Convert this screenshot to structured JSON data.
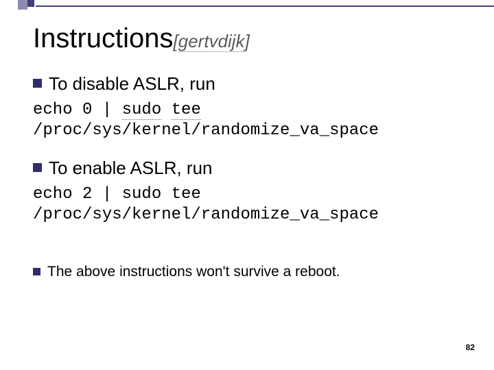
{
  "title": {
    "main": "Instructions",
    "ref_open": "[",
    "ref_author": "gertvdijk",
    "ref_close": "]"
  },
  "bullets": {
    "disable": "To disable ASLR, run",
    "enable": "To enable ASLR, run",
    "note": "The above instructions won't survive a reboot."
  },
  "code1": {
    "part1": "echo 0 | ",
    "sudo": "sudo",
    "space": " ",
    "tee": "tee",
    "line2": "/proc/sys/kernel/randomize_va_space"
  },
  "code2": {
    "line1": "echo 2 | sudo tee",
    "line2": "/proc/sys/kernel/randomize_va_space"
  },
  "page": "82"
}
